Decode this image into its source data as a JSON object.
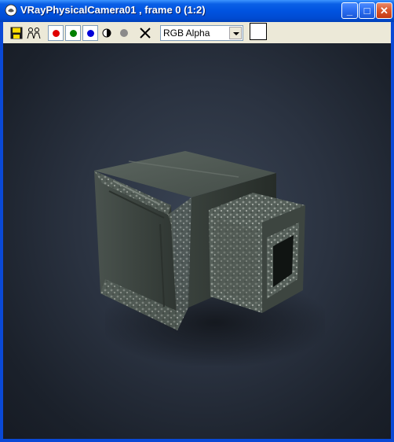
{
  "window": {
    "title": "VRayPhysicalCamera01 , frame 0 (1:2)",
    "buttons": {
      "minimize": "_",
      "maximize": "□",
      "close": "✕"
    }
  },
  "toolbar": {
    "icons": [
      "save-icon",
      "clone-icon",
      "red-channel-icon",
      "green-channel-icon",
      "blue-channel-icon",
      "monochrome-icon",
      "alpha-channel-icon",
      "clear-icon"
    ],
    "channel_select": {
      "selected": "RGB Alpha"
    },
    "colors": {
      "red": "#e00000",
      "green": "#008000",
      "blue": "#0000d8",
      "swatch": "#ffffff"
    }
  },
  "render": {
    "subject": "metal-box-model-icon",
    "background_color": "#2a3240"
  }
}
